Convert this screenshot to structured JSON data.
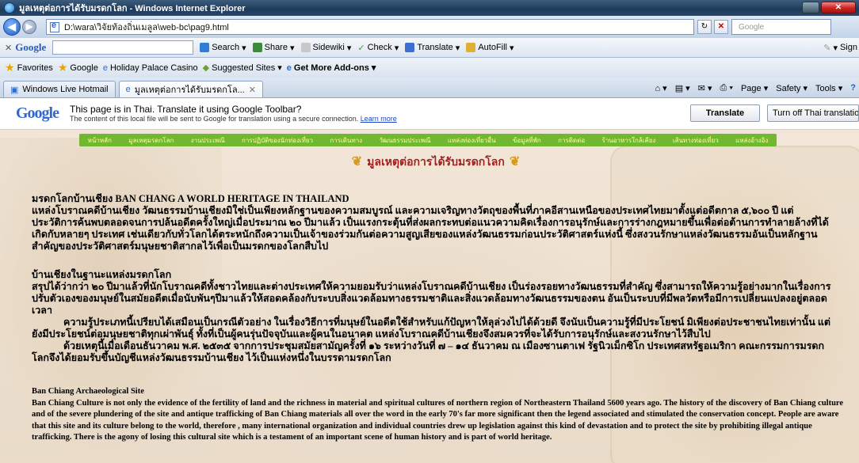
{
  "window": {
    "title": "มูลเหตุต่อการได้รับมรดกโลก - Windows Internet Explorer"
  },
  "address_bar": {
    "url": "D:\\wara\\วิจัยท้องถิ่นเมลูล\\web-bc\\pag9.html"
  },
  "search_box": {
    "placeholder": "Google"
  },
  "google_toolbar": {
    "label": "Google",
    "items": [
      "Search",
      "Share",
      "Sidewiki",
      "Check",
      "Translate",
      "AutoFill",
      "Sign"
    ]
  },
  "favorites_bar": {
    "items": [
      "Favorites",
      "Google",
      "Holiday Palace Casino",
      "Suggested Sites",
      "Get More Add-ons"
    ]
  },
  "tabs": {
    "items": [
      "Windows Live Hotmail",
      "มูลเหตุต่อการได้รับมรดกโล..."
    ],
    "tools": [
      "Page",
      "Safety",
      "Tools"
    ]
  },
  "translate_bar": {
    "logo": "Google",
    "line1": "This page is in Thai.  Translate it using Google Toolbar?",
    "line2": "The content of this local file will be sent to Google for translation using a secure connection.",
    "learn_more": "Learn more",
    "translate_button": "Translate",
    "turn_off_button": "Turn off Thai translation"
  },
  "page": {
    "menu": [
      "หน้าหลัก",
      "มูลเหตุมรดกโลก",
      "งานประเพณี",
      "การปฏิบัติของนักท่องเที่ยว",
      "การเดินทาง",
      "วัฒนธรรมประเพณี",
      "แหล่งท่องเที่ยวอื่น",
      "ข้อมูลที่พัก",
      "การติดต่อ",
      "ร้านอาหารใกล้เคียง",
      "เส้นทางท่องเที่ยว",
      "แหล่งอ้างอิง"
    ],
    "heading": "มูลเหตุต่อการได้รับมรดกโลก",
    "p1_title": "มรดกโลกบ้านเชียง BAN CHANG A WORLD HERITAGE IN THAILAND",
    "p1_body": "แหล่งโบราณคดีบ้านเชียง วัฒนธรรมบ้านเชียงมิใช่เป็นเพียงหลักฐานของความสมบูรณ์ และความเจริญทางวัตถุของพื้นที่ภาคอีสานเหนือของประเทศไทยมาตั้งแต่อดีตกาล ๕,๖๐๐ ปี แต่ประวัติการค้นพบตลอดจนการปล้นอดีตครั้งใหญ่เมื่อประมาณ ๒๐ ปีมาแล้ว เป็นแรงกระตุ้นที่ส่งผลกระทบต่อแนวความคิดเรื่องการอนุรักษ์และการร่างกฎหมายขึ้นเพื่อต่อต้านการทำลายล้างที่ได้เกิดกับหลายๆ ประเทศ เช่นเดียวกับทั่วโลกได้ตระหนักถึงความเป็นเจ้าของร่วมกันต่อความสูญเสียของแหล่งวัฒนธรรมก่อนประวัติศาสตร์แห่งนี้ ซึ่งสงวนรักษาแหล่งวัฒนธรรมอันเป็นหลักฐานสำคัญของประวัติศาสตร์มนุษยชาติสากลไว้เพื่อเป็นมรดกของโลกสืบไป",
    "p2_title": "บ้านเชียงในฐานะแหล่งมรดกโลก",
    "p2_body": "สรุปได้ว่ากว่า ๒๐ ปีมาแล้วที่นักโบราณคดีทั้งชาวไทยและต่างประเทศให้ความยอมรับว่าแหล่งโบราณคดีบ้านเชียง เป็นร่องรอยทางวัฒนธรรมที่สำคัญ ซึ่งสามารถให้ความรู้อย่างมากในเรื่องการปรับตัวเองของมนุษย์ในสมัยอดีตเมื่อนับพันๆปีมาแล้วให้สอดคล้องกับระบบสิ่งแวดล้อมทางธรรมชาติและสิ่งแวดล้อมทางวัฒนธรรมของตน อันเป็นระบบที่มีพลวัตหรือมีการเปลี่ยนแปลงอยู่ตลอดเวลา",
    "p3_body": "ความรู้ประเภทนี้เปรียบได้เสมือนเป็นกรณีตัวอย่าง ในเรื่องวิธีการที่มนุษย์ในอดีตใช้สำหรับแก้ปัญหาให้ลุล่วงไปได้ด้วยดี จึงนับเป็นความรู้ที่มีประโยชน์ มิเพียงต่อประชาชนไทยเท่านั้น แต่ยังมีประโยชน์ต่อมนุษยชาติทุกเผ่าพันธุ์ ทั้งที่เป็นผู้คนรุ่นปัจจุบันและผู้คนในอนาคต แหล่งโบราณคดีบ้านเชียงจึงสมควรที่จะได้รับการอนุรักษ์และสงวนรักษาไว้สืบไป",
    "p4_body": "ด้วยเหตุนี้เมื่อเดือนธันวาคม พ.ศ. ๒๕๓๕ จากการประชุมสมัยสามัญครั้งที่ ๑๖ ระหว่างวันที่ ๗ – ๑๔ ธันวาคม ณ เมืองซานตาเฟ รัฐนิวเม็กซิโก ประเทศสหรัฐอเมริกา คณะกรรมการมรดกโลกจึงได้ยอมรับขึ้นบัญชีแหล่งวัฒนธรรมบ้านเชียง ไว้เป็นแห่งหนึ่งในบรรดามรดกโลก",
    "eng_title": "Ban Chiang Archaeological Site",
    "eng_body": "Ban Chiang Culture is not only the evidence of the fertility of land and the richness in material and spiritual cultures of northern region of Northeastern Thailand 5600 years ago. The history of the discovery of Ban Chiang culture and of the severe plundering of the site and antique trafficking of Ban Chiang materials all over the word in the early 70's far more significant then the legend associated and stimulated the conservation concept. People are aware that this site and its culture belong to the world, therefore , many international organization and individual countries drew up legislation against this kind of devastation and to protect the site by prohibiting illegal antique trafficking. There is the agony of losing this cultural site which is a testament of an  important scene of human history and is part of world heritage."
  }
}
